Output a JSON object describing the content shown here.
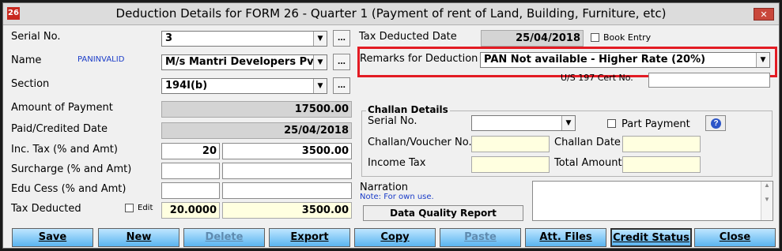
{
  "window": {
    "title": "Deduction Details for FORM 26 - Quarter 1 (Payment of rent of Land, Building, Furniture, etc)",
    "icon_text": "26",
    "close_glyph": "✕"
  },
  "left": {
    "serial_label": "Serial No.",
    "serial_value": "3",
    "name_label": "Name",
    "name_flag": "PANINVALID",
    "name_value": "M/s Mantri Developers Pvt l",
    "section_label": "Section",
    "section_value": "194I(b)",
    "amount_label": "Amount of Payment",
    "amount_value": "17500.00",
    "paid_label": "Paid/Credited Date",
    "paid_value": "25/04/2018",
    "inctax_label": "Inc. Tax (% and Amt)",
    "inctax_pct": "20",
    "inctax_amt": "3500.00",
    "surcharge_label": "Surcharge (% and Amt)",
    "surcharge_pct": "",
    "surcharge_amt": "",
    "educess_label": "Edu Cess (% and Amt)",
    "educess_pct": "",
    "educess_amt": "",
    "taxded_label": "Tax Deducted",
    "edit_label": "Edit",
    "taxded_pct": "20.0000",
    "taxded_amt": "3500.00",
    "dots": "..."
  },
  "right": {
    "taxdate_label": "Tax Deducted Date",
    "taxdate_value": "25/04/2018",
    "book_entry_label": "Book Entry",
    "remarks_label": "Remarks for Deduction",
    "remarks_value": "PAN Not available - Higher Rate (20%)",
    "cert_label": "U/S 197 Cert No.",
    "cert_value": "",
    "challan_group": "Challan Details",
    "challan_serial_label": "Serial No.",
    "challan_serial_value": "",
    "part_payment_label": "Part Payment",
    "voucher_label": "Challan/Voucher No.",
    "voucher_value": "",
    "challan_date_label": "Challan Date",
    "challan_date_value": "",
    "income_tax_label": "Income Tax",
    "income_tax_value": "",
    "total_amount_label": "Total Amount",
    "total_amount_value": "",
    "narration_label": "Narration",
    "narration_note": "Note: For own use.",
    "dq_report_label": "Data Quality Report",
    "help_glyph": "?"
  },
  "buttons": {
    "save": "Save",
    "new": "New",
    "delete": "Delete",
    "export": "Export",
    "copy": "Copy",
    "paste": "Paste",
    "att_files": "Att. Files",
    "credit_status": "Credit Status",
    "close": "Close"
  },
  "colors": {
    "highlight_red": "#e31b23",
    "link_blue": "#1a3cc8",
    "button_blue": "#5ab4f0"
  }
}
